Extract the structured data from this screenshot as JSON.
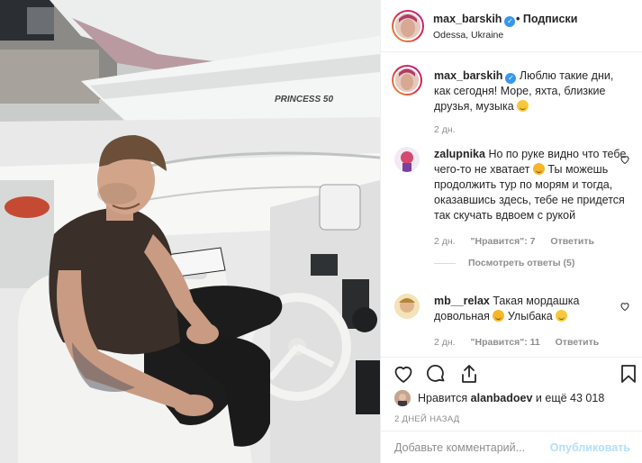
{
  "post": {
    "username": "max_barskih",
    "verified": true,
    "follow_label": "Подписки",
    "location": "Odessa, Ukraine",
    "caption": {
      "username": "max_barskih",
      "text": "Люблю такие дни, как сегодня! Море, яхта, близкие друзья, музыка",
      "age": "2 дн."
    },
    "boat_name": "PRINCESS 50"
  },
  "comments": [
    {
      "username": "zalupnika",
      "text_a": "Но по руке видно что тебе чего-то не хватает",
      "text_b": "Ты можешь продолжить тур по морям и тогда, оказавшись здесь, тебе не придется так скучать вдвоем с рукой",
      "age": "2 дн.",
      "likes": "\"Нравится\": 7",
      "reply_label": "Ответить",
      "view_replies": "Посмотреть ответы (5)"
    },
    {
      "username": "mb__relax",
      "text_a": "Такая мордашка довольная",
      "text_b": "Улыбака",
      "age": "2 дн.",
      "likes": "\"Нравится\": 11",
      "reply_label": "Ответить"
    }
  ],
  "likes_line": {
    "prefix": "Нравится",
    "user": "alanbadoev",
    "suffix": "и ещё 43 018"
  },
  "timestamp": "2 ДНЕЙ НАЗАД",
  "add_comment": {
    "placeholder": "Добавьте комментарий...",
    "publish_label": "Опубликовать"
  },
  "colors": {
    "verified": "#3897f0",
    "muted": "#8e8e8e",
    "publish_disabled": "#b2dffc",
    "text": "#262626"
  },
  "icons": [
    "heart-icon",
    "comment-icon",
    "share-icon",
    "bookmark-icon",
    "verified-icon"
  ]
}
